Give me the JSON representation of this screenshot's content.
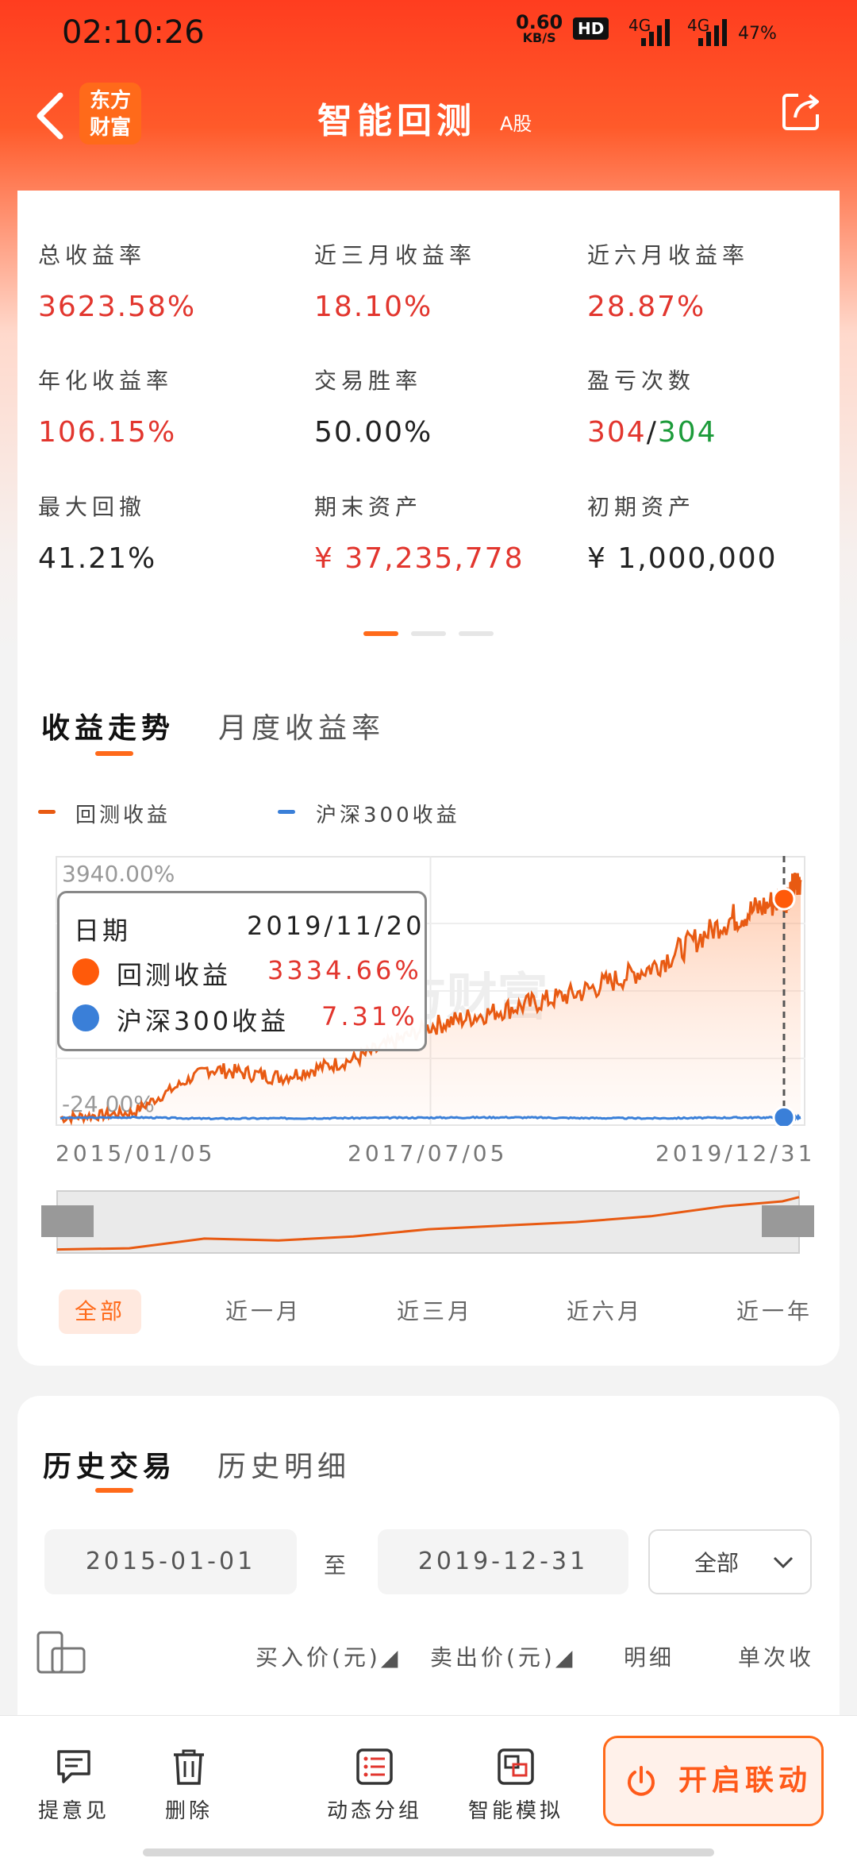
{
  "status_bar": {
    "time": "02:10:26",
    "net_speed": "0.60",
    "net_unit": "KB/S",
    "hd": "HD",
    "sig1": "4G",
    "sig2": "4G",
    "battery": "47%"
  },
  "nav": {
    "logo_line1": "东方",
    "logo_line2": "财富",
    "title": "智能回测",
    "subtitle": "A股"
  },
  "stats": [
    {
      "label": "总收益率",
      "value": "3623.58%",
      "color": "#e2362e"
    },
    {
      "label": "近三月收益率",
      "value": "18.10%",
      "color": "#e2362e"
    },
    {
      "label": "近六月收益率",
      "value": "28.87%",
      "color": "#e2362e"
    },
    {
      "label": "年化收益率",
      "value": "106.15%",
      "color": "#e2362e"
    },
    {
      "label": "交易胜率",
      "value": "50.00%",
      "color": "#222222"
    },
    {
      "label": "盈亏次数",
      "value_win": "304",
      "value_sep": "/",
      "value_loss": "304"
    },
    {
      "label": "最大回撤",
      "value": "41.21%",
      "color": "#222222"
    },
    {
      "label": "期末资产",
      "value": "¥ 37,235,778",
      "color": "#e2362e"
    },
    {
      "label": "初期资产",
      "value": "¥ 1,000,000",
      "color": "#222222"
    }
  ],
  "chart_tabs": {
    "active": "收益走势",
    "inactive": "月度收益率"
  },
  "legend": {
    "strategy": "回测收益",
    "benchmark": "沪深300收益"
  },
  "tooltip": {
    "date_label": "日期",
    "date_value": "2019/11/20",
    "strategy_label": "回测收益",
    "strategy_value": "3334.66%",
    "benchmark_label": "沪深300收益",
    "benchmark_value": "7.31%"
  },
  "watermark": "东方财富",
  "chart_data": {
    "type": "line",
    "x_ticks": [
      "2015/01/05",
      "2017/07/05",
      "2019/12/31"
    ],
    "y_ticks": [
      "3940.00%",
      "-24.00%"
    ],
    "ylim": [
      -24,
      3940
    ],
    "x": [
      "2015/01/05",
      "2015/07/01",
      "2016/01/01",
      "2016/07/01",
      "2017/01/01",
      "2017/07/05",
      "2018/01/01",
      "2018/07/01",
      "2019/01/01",
      "2019/07/01",
      "2019/11/20",
      "2019/12/31"
    ],
    "series": [
      {
        "name": "回测收益",
        "color": "#e85a12",
        "values": [
          0,
          80,
          750,
          620,
          900,
          1400,
          1650,
          1900,
          2300,
          3000,
          3334.66,
          3623.58
        ]
      },
      {
        "name": "沪深300收益",
        "color": "#3a7fd8",
        "values": [
          0,
          10,
          -10,
          -5,
          0,
          5,
          10,
          0,
          -5,
          5,
          7.31,
          8
        ]
      }
    ],
    "marker_date": "2019/11/20"
  },
  "ranges": [
    "全部",
    "近一月",
    "近三月",
    "近六月",
    "近一年"
  ],
  "history": {
    "tab_active": "历史交易",
    "tab_inactive": "历史明细",
    "start_date": "2015-01-01",
    "to": "至",
    "end_date": "2019-12-31",
    "filter": "全部",
    "columns": [
      "买入价(元)◢",
      "卖出价(元)◢",
      "明细",
      "单次收"
    ]
  },
  "bottom_bar": {
    "feedback": "提意见",
    "delete": "删除",
    "dynamic_group": "动态分组",
    "simulate": "智能模拟",
    "linkage": "开启联动"
  },
  "colors": {
    "accent": "#ff6a1a",
    "header": "#ff3d1f",
    "up": "#e2362e",
    "down": "#1c9b3a",
    "benchmark": "#3a7fd8"
  }
}
